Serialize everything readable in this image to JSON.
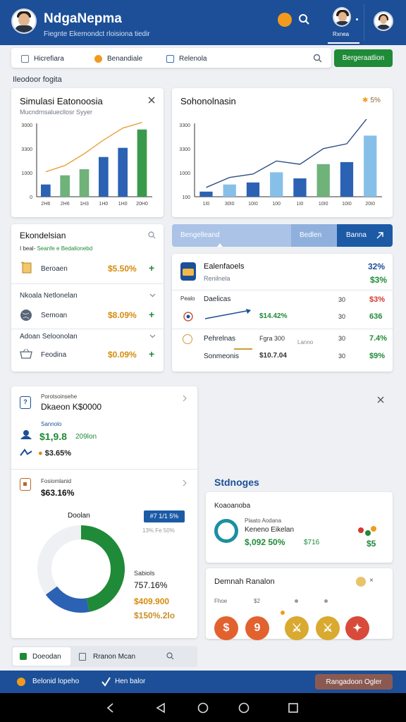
{
  "app": {
    "title": "NdgaNepma",
    "subtitle": "Fiegnte Ekemondct rloisiona tiedir",
    "user_label": "Rxnea"
  },
  "colors": {
    "primary": "#1c4f97",
    "accent_green": "#1f8a37",
    "gold": "#d68b0d",
    "red": "#d23a2e"
  },
  "tabs": [
    {
      "label": "Hicrefiara",
      "icon": "document-icon"
    },
    {
      "label": "Benandiale",
      "icon": "coin-icon"
    },
    {
      "label": "Relenola",
      "icon": "calculator-icon"
    }
  ],
  "tab_action": "Bergeraatlion",
  "section_title": "Ileodoor fogita",
  "chart1": {
    "title": "Simulasi Eatonoosia",
    "subtitle": "Mucndrnsaluecllosr Syyer",
    "yticks": [
      "3000",
      "3300",
      "1000",
      "0"
    ],
    "xticks": [
      "2H6",
      "2H6",
      "1H3",
      "1H0",
      "1H0",
      "20H0"
    ],
    "close_icon": "close-icon"
  },
  "chart2": {
    "title": "Sohonolnasin",
    "badge": "5%",
    "yticks": [
      "3300",
      "3300",
      "1000",
      "100"
    ],
    "xticks": [
      "1I0",
      "30I0",
      "10I0",
      "100",
      "1I0",
      "10I0",
      "10I0",
      "20I0"
    ]
  },
  "chart_data": [
    {
      "type": "bar",
      "title": "Simulasi Eatonoosia",
      "categories": [
        "2H6",
        "2H6",
        "1H3",
        "1H0",
        "1H0",
        "20H0"
      ],
      "series": [
        {
          "values": [
            600,
            1050,
            1350,
            1950,
            2400,
            3300
          ]
        }
      ],
      "ylim": [
        0,
        3600
      ]
    },
    {
      "type": "bar",
      "title": "Sohonolnasin",
      "categories": [
        "1I0",
        "30I0",
        "10I0",
        "100",
        "1I0",
        "10I0",
        "10I0",
        "20I0"
      ],
      "series": [
        {
          "values": [
            250,
            600,
            700,
            1200,
            900,
            1600,
            1700,
            3000
          ]
        }
      ],
      "ylim": [
        0,
        3600
      ]
    }
  ],
  "left_list": {
    "title": "Ekondelsian",
    "meta_prefix": "I beal-",
    "meta_green": "Seanfe e Bedalionebd",
    "items": [
      {
        "label": "Beroaen",
        "value": "$5.50%"
      },
      {
        "label": "Semoan",
        "value": "$8.09%"
      },
      {
        "label": "Feodina",
        "value": "$0.09%"
      }
    ],
    "sections": [
      "Nkoala Netlonelan",
      "Adoan Seloonolan"
    ]
  },
  "right_panel": {
    "tab1": "Bengelleand",
    "tab2": "Bedlen",
    "tab3": "Banna",
    "card_title": "Ealenfaoels",
    "card_sub": "Renilnela",
    "pct1": "32%",
    "pct2": "$3%",
    "rows": [
      {
        "label": "Daelicas",
        "value": "$14.42%",
        "n": "30",
        "v": "$3%"
      },
      {
        "label": "Pehrelnas",
        "value": "Fgra 300",
        "extra": "Lanno",
        "n": "30",
        "v": "7.4%"
      },
      {
        "label": "Sonmeonis",
        "value": "$10.7.04",
        "n": "30",
        "v": "$9%"
      }
    ],
    "row_extra_v": "636",
    "row_prefix": "Pealo"
  },
  "wallet": {
    "label": "Porotsoinsehe",
    "amount": "Dkaeon K$0000",
    "sub_label": "Sannolo",
    "main_value": "$1,9.8",
    "main_suffix": "209lon",
    "pct": "$3.65%",
    "second_label": "Fosiomlanid",
    "second_value": "$63.16%"
  },
  "donut": {
    "title": "Doolan",
    "tag": "#7 1/1 5%",
    "tag_sub": "13% Fe 50%",
    "legend_title": "Sabiols",
    "v1": "757.16%",
    "v2": "$409.900",
    "v3": "$150%.2lo",
    "chart": {
      "segments": [
        {
          "value": 47
        },
        {
          "value": 18
        },
        {
          "value": 35
        }
      ]
    }
  },
  "bottom_right": {
    "title": "Stdnoges",
    "sub": "Koaoanoba",
    "row_title": "Plaato Aodana",
    "row_label": "Keneno Eikelan",
    "row_value": "$,092 50%",
    "row_v2": "$716",
    "badge_v": "$5",
    "section": "Demnah Ranalon",
    "coin_labels": [
      "Fhoe",
      "$2"
    ]
  },
  "bottom_tabs": {
    "t1": "Doeodan",
    "t2": "Rranon Mcan"
  },
  "footer": {
    "left": "Belonid lopeho",
    "mid": "Hen balor",
    "right": "Rangadoon Ogler"
  }
}
